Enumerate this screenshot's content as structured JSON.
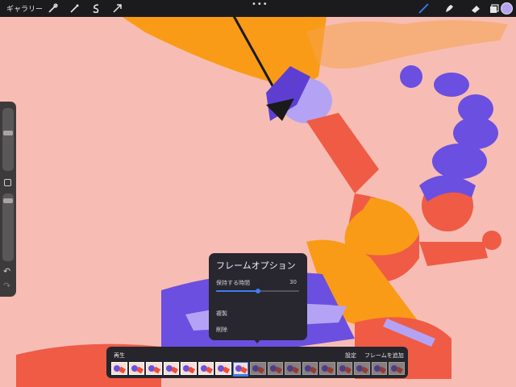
{
  "topbar": {
    "gallery_label": "ギャラリー",
    "more_label": "•••",
    "tools_left": [
      "wrench-icon",
      "magic-wand-icon",
      "selection-icon",
      "transform-arrow-icon"
    ],
    "tools_right": [
      "brush-icon",
      "smudge-icon",
      "eraser-icon",
      "layers-icon"
    ],
    "current_color": "#b5a3f2"
  },
  "sidebar": {
    "brush_size_level": 0.18,
    "opacity_level": 0.05
  },
  "frame_options": {
    "title": "フレームオプション",
    "hold_label": "保持する時間",
    "hold_value": "30",
    "hold_slider_fraction": 0.5,
    "duplicate_label": "複製",
    "delete_label": "削除"
  },
  "timeline": {
    "play_label": "再生",
    "settings_label": "設定",
    "add_frame_label": "フレームを追加",
    "frame_count": 17,
    "selected_frame": 8
  },
  "colors": {
    "background": "#f7bdb4",
    "accent": "#3d7df0",
    "orange": "#f99b17",
    "purple": "#5e3ed1",
    "red": "#ef5b45"
  }
}
